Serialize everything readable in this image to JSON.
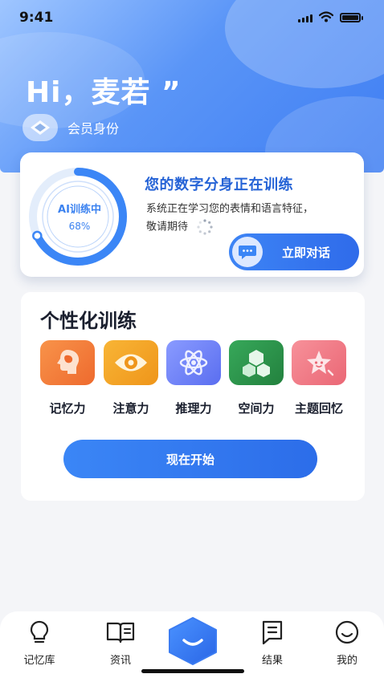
{
  "status": {
    "time": "9:41"
  },
  "header": {
    "greeting": "Hi，麦若 ”",
    "member_label": "会员身份"
  },
  "ai_card": {
    "ring_label": "AI训练中",
    "progress_text": "68%",
    "progress": 0.68,
    "title": "您的数字分身正在训练",
    "desc_line1": "系统正在学习您的表情和语言特征，",
    "desc_line2": "敬请期待",
    "chat_button": "立即对话"
  },
  "training": {
    "title": "个性化训练",
    "skills": [
      {
        "name": "记忆力",
        "icon": "head-icon",
        "color": "#f0763a"
      },
      {
        "name": "注意力",
        "icon": "eye-icon",
        "color": "#f3a21d"
      },
      {
        "name": "推理力",
        "icon": "atom-icon",
        "color": "#6a7ef5"
      },
      {
        "name": "空间力",
        "icon": "cubes-icon",
        "color": "#2f9a4f"
      },
      {
        "name": "主题回忆",
        "icon": "star-icon",
        "color": "#f07a86"
      }
    ],
    "start_button": "现在开始"
  },
  "tabbar": {
    "items": [
      {
        "label": "记忆库",
        "icon": "lightbulb-icon"
      },
      {
        "label": "资讯",
        "icon": "book-icon"
      },
      {
        "label": "",
        "icon": "home-smile-icon"
      },
      {
        "label": "结果",
        "icon": "document-icon"
      },
      {
        "label": "我的",
        "icon": "smile-icon"
      }
    ]
  },
  "colors": {
    "primary": "#2f6bea",
    "accent_text": "#2563d6"
  }
}
